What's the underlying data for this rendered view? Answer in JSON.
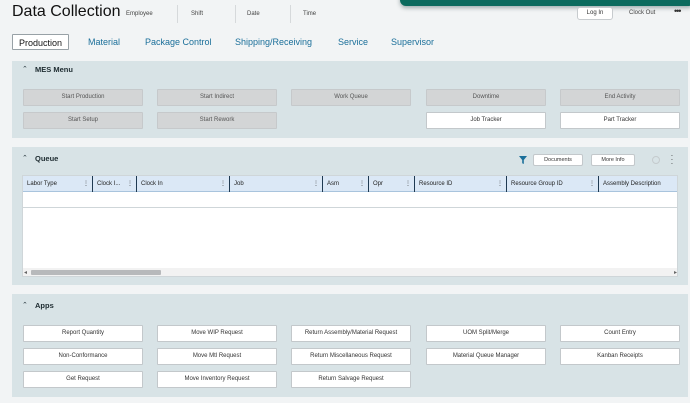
{
  "header": {
    "title": "Data Collection",
    "fields": [
      "Employee",
      "Shift",
      "Date",
      "Time"
    ],
    "login_label": "Log In",
    "clockout_label": "Clock Out",
    "more_icon": "ellipsis-icon"
  },
  "tabs": [
    {
      "label": "Production",
      "active": true
    },
    {
      "label": "Material"
    },
    {
      "label": "Package Control"
    },
    {
      "label": "Shipping/Receiving"
    },
    {
      "label": "Service"
    },
    {
      "label": "Supervisor"
    }
  ],
  "mes_menu": {
    "title": "MES Menu",
    "buttons": [
      {
        "label": "Start Production",
        "enabled": false
      },
      {
        "label": "Start Indirect",
        "enabled": false
      },
      {
        "label": "Work Queue",
        "enabled": false
      },
      {
        "label": "Downtime",
        "enabled": false
      },
      {
        "label": "End Activity",
        "enabled": false
      },
      {
        "label": "Start Setup",
        "enabled": false
      },
      {
        "label": "Start Rework",
        "enabled": false
      },
      {
        "label": "Job Tracker",
        "enabled": true
      },
      {
        "label": "Part Tracker",
        "enabled": true
      }
    ]
  },
  "queue": {
    "title": "Queue",
    "documents_label": "Documents",
    "more_info_label": "More Info",
    "columns": [
      "Labor Type",
      "Clock I...",
      "Clock In",
      "Job",
      "Asm",
      "Opr",
      "Resource ID",
      "Resource Group ID",
      "Assembly Description"
    ]
  },
  "apps": {
    "title": "Apps",
    "buttons": [
      {
        "label": "Report Quantity"
      },
      {
        "label": "Move WIP Request"
      },
      {
        "label": "Return Assembly/Material Request"
      },
      {
        "label": "UOM Split/Merge"
      },
      {
        "label": "Count Entry"
      },
      {
        "label": "Non-Conformance"
      },
      {
        "label": "Move Mtl Request"
      },
      {
        "label": "Return Miscellaneous Request"
      },
      {
        "label": "Material Queue Manager"
      },
      {
        "label": "Kanban Receipts"
      },
      {
        "label": "Get Request"
      },
      {
        "label": "Move Inventory Request"
      },
      {
        "label": "Return Salvage Request"
      }
    ]
  },
  "colors": {
    "accent_link": "#1b6f9a",
    "panel_bg": "#d8e3e6",
    "banner": "#0b6b5e"
  }
}
